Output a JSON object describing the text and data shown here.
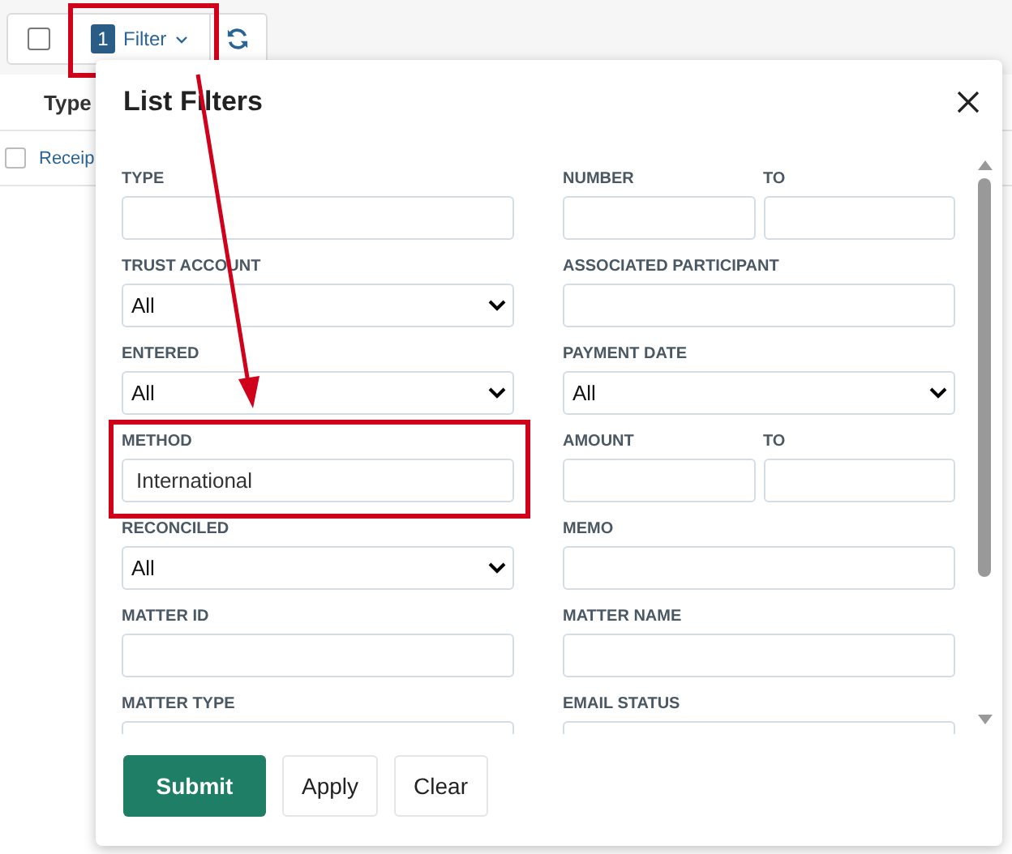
{
  "toolbar": {
    "select_all_checked": false,
    "filter_button": {
      "badge": "1",
      "label": "Filter",
      "highlighted": true
    }
  },
  "table": {
    "columns": [
      "Type"
    ],
    "rows": [
      {
        "checked": false,
        "cells": [
          "Receip"
        ]
      }
    ]
  },
  "dialog": {
    "title": "List Filters",
    "rows": [
      [
        {
          "kind": "text",
          "label": "TYPE"
        },
        {
          "kind": "range",
          "label": "NUMBER",
          "to_label": "TO"
        }
      ],
      [
        {
          "kind": "select",
          "label": "TRUST ACCOUNT",
          "value": "All"
        },
        {
          "kind": "text",
          "label": "ASSOCIATED PARTICIPANT"
        }
      ],
      [
        {
          "kind": "select",
          "label": "ENTERED",
          "value": "All"
        },
        {
          "kind": "select",
          "label": "PAYMENT DATE",
          "value": "All"
        }
      ],
      [
        {
          "kind": "text",
          "label": "METHOD",
          "value": "International",
          "highlighted": true
        },
        {
          "kind": "range",
          "label": "AMOUNT",
          "to_label": "TO"
        }
      ],
      [
        {
          "kind": "select",
          "label": "RECONCILED",
          "value": "All"
        },
        {
          "kind": "text",
          "label": "MEMO"
        }
      ],
      [
        {
          "kind": "text",
          "label": "MATTER ID"
        },
        {
          "kind": "text",
          "label": "MATTER NAME"
        }
      ],
      [
        {
          "kind": "text",
          "label": "MATTER TYPE"
        },
        {
          "kind": "text",
          "label": "EMAIL STATUS"
        }
      ]
    ],
    "buttons": [
      {
        "label": "Submit",
        "kind": "primary"
      },
      {
        "label": "Apply",
        "kind": "plain"
      },
      {
        "label": "Clear",
        "kind": "plain"
      }
    ]
  },
  "annotation_arrow": true
}
